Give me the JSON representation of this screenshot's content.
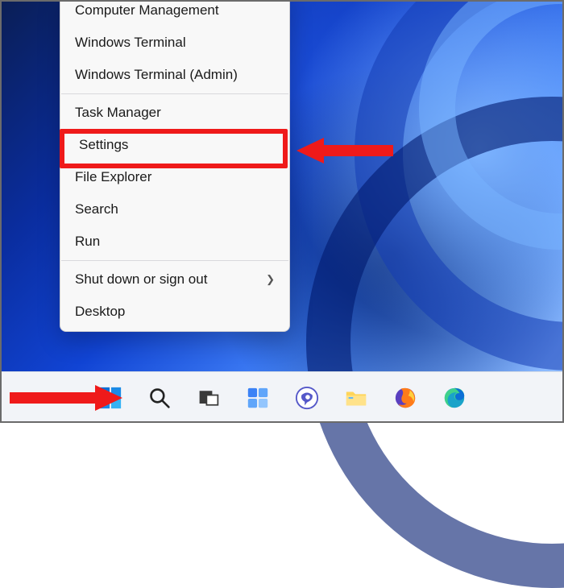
{
  "menu": {
    "items": [
      {
        "label": "Computer Management"
      },
      {
        "label": "Windows Terminal"
      },
      {
        "label": "Windows Terminal (Admin)"
      }
    ],
    "items2": [
      {
        "label": "Task Manager"
      },
      {
        "label": "Settings"
      },
      {
        "label": "File Explorer"
      },
      {
        "label": "Search"
      },
      {
        "label": "Run"
      }
    ],
    "items3": [
      {
        "label": "Shut down or sign out",
        "submenu": true
      },
      {
        "label": "Desktop"
      }
    ]
  },
  "taskbar": {
    "icons": [
      "start",
      "search",
      "task-view",
      "widgets",
      "chat",
      "file-explorer",
      "firefox",
      "edge"
    ]
  },
  "annotation": {
    "highlight_target": "Settings",
    "arrow_color": "#ef1a1a"
  }
}
